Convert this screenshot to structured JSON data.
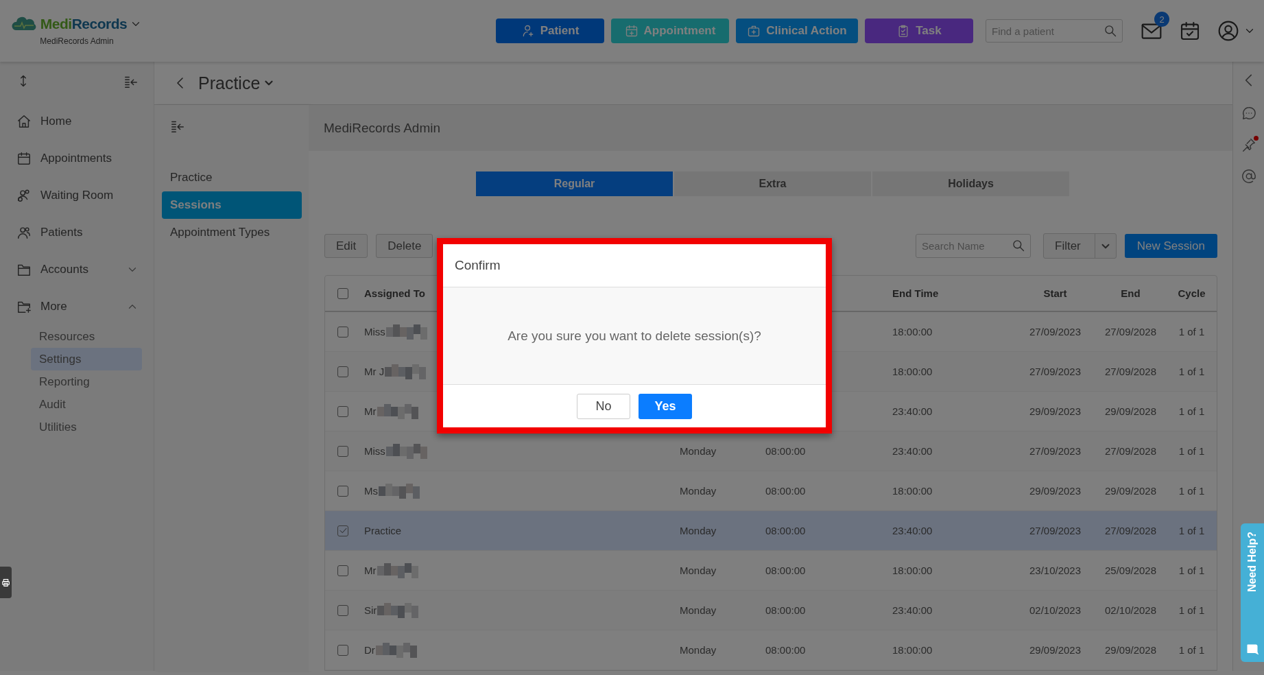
{
  "app": {
    "logo_first": "Medi",
    "logo_rest": "Records",
    "subtitle": "MediRecords Admin"
  },
  "quick_actions": [
    {
      "label": "Patient",
      "kind": "patient"
    },
    {
      "label": "Appointment",
      "kind": "appointment"
    },
    {
      "label": "Clinical Action",
      "kind": "clinical"
    },
    {
      "label": "Task",
      "kind": "task"
    }
  ],
  "patient_search": {
    "placeholder": "Find a patient"
  },
  "inbox": {
    "badge": "2"
  },
  "sidebar": {
    "items": [
      {
        "label": "Home",
        "kind": "home",
        "selected": false
      },
      {
        "label": "Appointments",
        "kind": "appointments",
        "selected": false
      },
      {
        "label": "Waiting Room",
        "kind": "waiting",
        "selected": false
      },
      {
        "label": "Patients",
        "kind": "patients",
        "selected": false
      },
      {
        "label": "Accounts",
        "kind": "accounts",
        "selected": false,
        "expanded": false
      },
      {
        "label": "More",
        "kind": "more",
        "selected": false,
        "expanded": true,
        "children": [
          {
            "label": "Resources",
            "selected": false
          },
          {
            "label": "Settings",
            "selected": true
          },
          {
            "label": "Reporting",
            "selected": false
          },
          {
            "label": "Audit",
            "selected": false
          },
          {
            "label": "Utilities",
            "selected": false
          }
        ]
      }
    ]
  },
  "page": {
    "title": "Practice"
  },
  "subnav": {
    "items": [
      {
        "label": "Practice",
        "selected": false
      },
      {
        "label": "Sessions",
        "selected": true
      },
      {
        "label": "Appointment Types",
        "selected": false
      }
    ]
  },
  "panel": {
    "title": "MediRecords Admin"
  },
  "tabs": [
    {
      "label": "Regular",
      "selected": true
    },
    {
      "label": "Extra",
      "selected": false
    },
    {
      "label": "Holidays",
      "selected": false
    }
  ],
  "toolbar": {
    "buttons": [
      "Edit",
      "Delete"
    ],
    "search": {
      "placeholder": "Search Name"
    },
    "filter": "Filter",
    "new_button": "New Session"
  },
  "table": {
    "header": {
      "checked": false,
      "assigned_to": "Assigned To",
      "end_time": "End Time",
      "start": "Start",
      "end": "End",
      "cycle": "Cycle"
    },
    "rows": [
      {
        "selected": false,
        "blurred": true,
        "assigned_to": "Miss",
        "end_time": "18:00:00",
        "start": "27/09/2023",
        "end": "27/09/2028",
        "cycle": "1 of 1"
      },
      {
        "selected": false,
        "blurred": true,
        "assigned_to": "Mr J",
        "end_time": "18:00:00",
        "start": "27/09/2023",
        "end": "27/09/2028",
        "cycle": "1 of 1"
      },
      {
        "selected": false,
        "blurred": true,
        "assigned_to": "Mr",
        "end_time": "23:40:00",
        "start": "29/09/2023",
        "end": "29/09/2028",
        "cycle": "1 of 1"
      },
      {
        "selected": false,
        "blurred": true,
        "assigned_to": "Miss",
        "day": "Monday",
        "start_time": "08:00:00",
        "end_time": "23:40:00",
        "start": "27/09/2023",
        "end": "27/09/2028",
        "cycle": "1 of 1"
      },
      {
        "selected": false,
        "blurred": true,
        "assigned_to": "Ms",
        "day": "Monday",
        "start_time": "08:00:00",
        "end_time": "18:00:00",
        "start": "29/09/2023",
        "end": "29/09/2028",
        "cycle": "1 of 1"
      },
      {
        "selected": true,
        "blurred": false,
        "assigned_to": "Practice",
        "day": "Monday",
        "start_time": "08:00:00",
        "end_time": "23:40:00",
        "start": "27/09/2023",
        "end": "27/09/2028",
        "cycle": "1 of 1"
      },
      {
        "selected": false,
        "blurred": true,
        "assigned_to": "Mr",
        "day": "Monday",
        "start_time": "08:00:00",
        "end_time": "18:00:00",
        "start": "23/10/2023",
        "end": "25/09/2028",
        "cycle": "1 of 1"
      },
      {
        "selected": false,
        "blurred": true,
        "assigned_to": "Sir",
        "day": "Monday",
        "start_time": "08:00:00",
        "end_time": "23:40:00",
        "start": "02/10/2023",
        "end": "02/10/2028",
        "cycle": "1 of 1"
      },
      {
        "selected": false,
        "blurred": true,
        "assigned_to": "Dr",
        "day": "Monday",
        "start_time": "08:00:00",
        "end_time": "18:00:00",
        "start": "29/09/2023",
        "end": "29/09/2028",
        "cycle": "1 of 1"
      }
    ]
  },
  "dialog": {
    "title": "Confirm",
    "message": "Are you sure you want to delete session(s)?",
    "buttons": [
      {
        "label": "No",
        "kind": "secondary"
      },
      {
        "label": "Yes",
        "kind": "primary"
      }
    ]
  },
  "help_tab": {
    "label": "Need Help?"
  }
}
